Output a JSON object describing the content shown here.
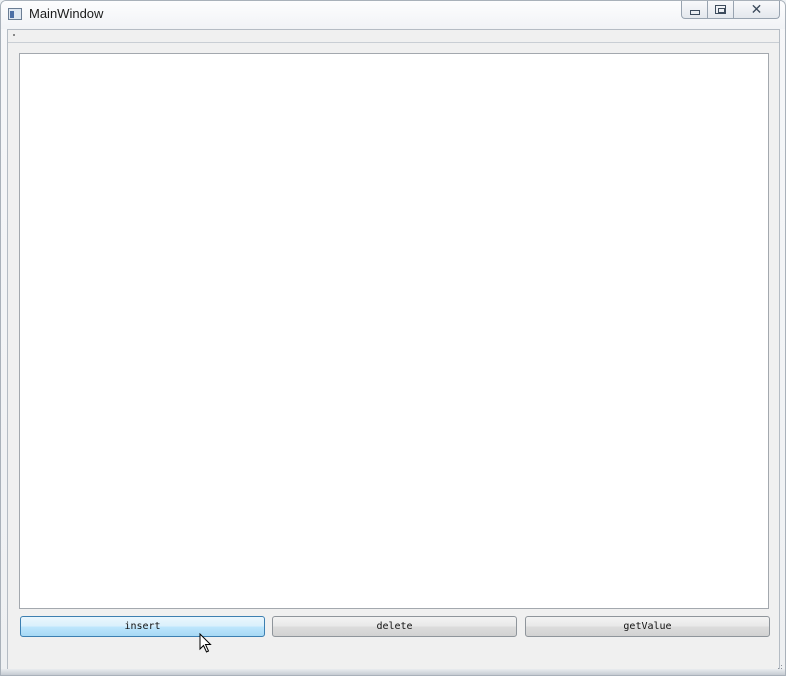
{
  "window": {
    "title": "MainWindow"
  },
  "caption_buttons": {
    "minimize_icon": "minimize-icon",
    "maximize_icon": "restore-icon",
    "close_glyph": "✕"
  },
  "list": {
    "items": []
  },
  "buttons": {
    "insert_label": "insert",
    "delete_label": "delete",
    "getvalue_label": "getValue"
  },
  "colors": {
    "hover_button_accent": "#bee6fd"
  }
}
